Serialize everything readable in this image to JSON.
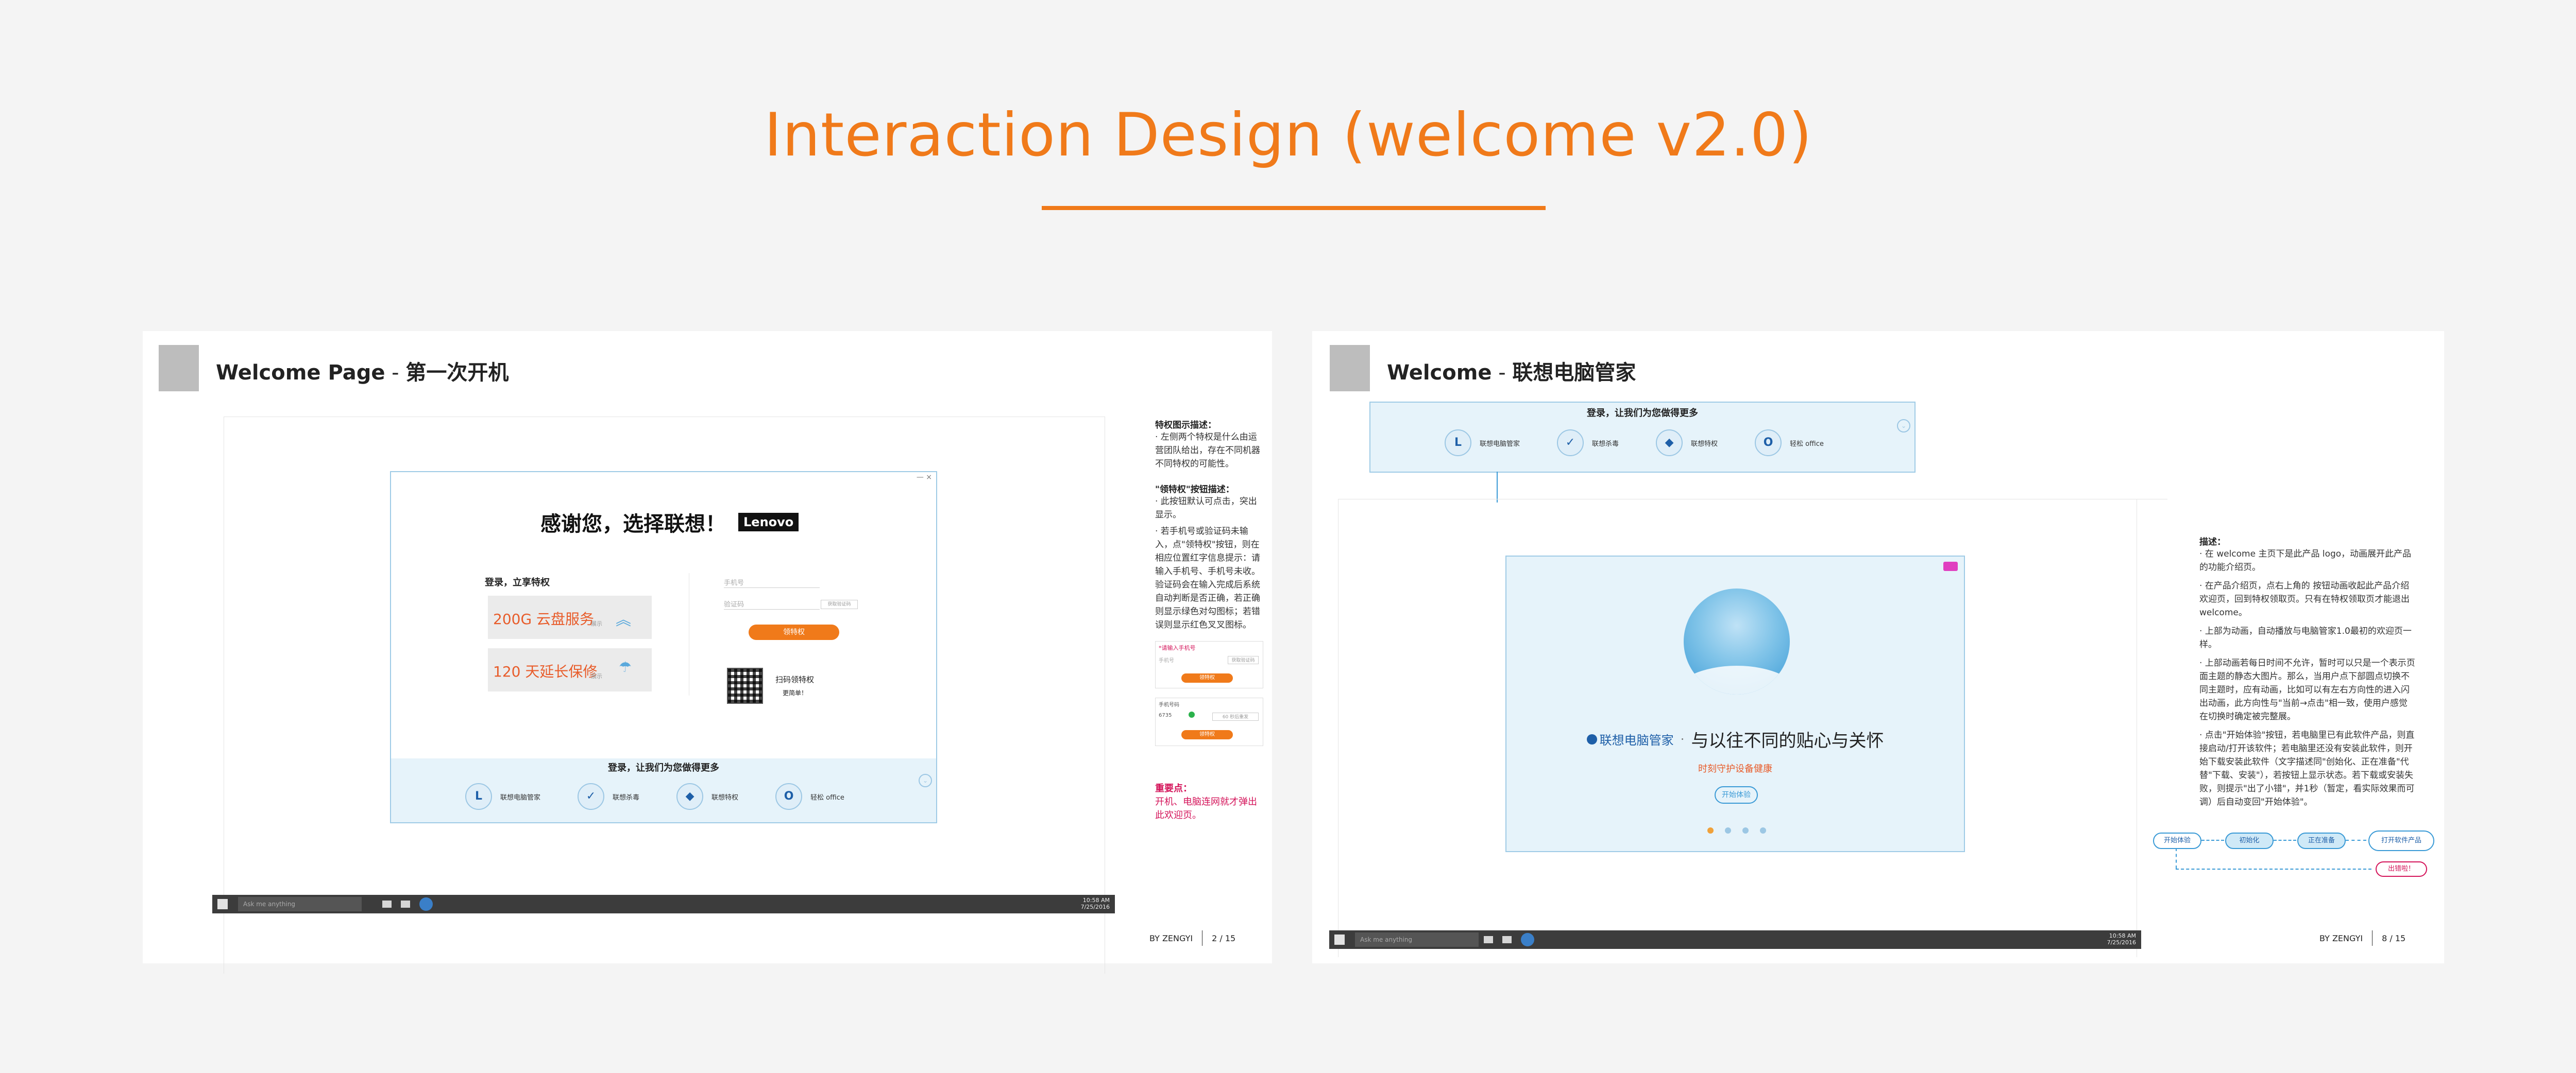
{
  "page": {
    "title": "Interaction Design (welcome v2.0)"
  },
  "slide1": {
    "heading_en": "Welcome Page",
    "heading_sep": " - ",
    "heading_cn": "第一次开机",
    "dialog": {
      "controls": "—   ×",
      "thanks": "感谢您，选择联想！",
      "brand": "Lenovo",
      "login_privilege": "登录，立享特权",
      "benefit1": "200G 云盘服务",
      "benefit2": "120 天延长保修",
      "benefit_tag": "展示",
      "phone_placeholder": "手机号",
      "code_placeholder": "验证码",
      "get_code": "获取验证码",
      "claim_button": "领特权",
      "scan_label": "扫码领特权",
      "scan_sub": "更简单！",
      "bar_title": "登录，让我们为您做得更多",
      "apps": [
        {
          "icon": "L",
          "label": "联想电脑管家"
        },
        {
          "icon": "✓",
          "label": "联想杀毒"
        },
        {
          "icon": "◆",
          "label": "联想特权"
        },
        {
          "icon": "O",
          "label": "轻松 office"
        }
      ]
    },
    "taskbar": {
      "search": "Ask me anything",
      "time": "10:58 AM",
      "date": "7/25/2016"
    },
    "notes": {
      "h1": "特权图示描述：",
      "p1": "· 左侧两个特权是什么由运营团队给出，存在不同机器不同特权的可能性。",
      "h2": "\"领特权\"按钮描述：",
      "p2": "· 此按钮默认可点击，突出显示。",
      "p3": "· 若手机号或验证码未输入，点\"领特权\"按钮，则在相应位置红字信息提示：请输入手机号、手机号未收。验证码会在输入完成后系统自动判断是否正确，若正确则显示绿色对勾图标；若错误则显示红色叉叉图标。",
      "mini1_error": "*请输入手机号",
      "mini1_phone": "手机号",
      "mini1_code": "获取验证码",
      "mini1_btn": "领特权",
      "mini2_phone": "手机号码",
      "mini2_code": "6735",
      "mini2_resend": "60 秒后重发",
      "mini2_btn": "领特权",
      "key_h": "重要点：",
      "key_p": "开机、电脑连网就才弹出此欢迎页。"
    },
    "footer": {
      "by": "BY ZENGYI",
      "page": "2 / 15"
    }
  },
  "slide2": {
    "heading_en": "Welcome",
    "heading_sep": " - ",
    "heading_cn": "联想电脑管家",
    "top_bar": {
      "title": "登录，让我们为您做得更多",
      "apps": [
        {
          "icon": "L",
          "label": "联想电脑管家"
        },
        {
          "icon": "✓",
          "label": "联想杀毒"
        },
        {
          "icon": "◆",
          "label": "联想特权"
        },
        {
          "icon": "O",
          "label": "轻松 office"
        }
      ]
    },
    "welcome": {
      "brand": "联想电脑管家",
      "dot_sep": "·",
      "slogan": "与以往不同的贴心与关怀",
      "subline": "时刻守护设备健康",
      "start_button": "开始体验"
    },
    "taskbar": {
      "search": "Ask me anything",
      "time": "10:58 AM",
      "date": "7/25/2016"
    },
    "notes": {
      "h": "描述：",
      "p1": "· 在 welcome 主页下是此产品 logo，动画展开此产品的功能介绍页。",
      "p2": "· 在产品介绍页，点右上角的    按钮动画收起此产品介绍欢迎页，回到特权领取页。只有在特权领取页才能退出 welcome。",
      "p3": "· 上部为动画，自动播放与电脑管家1.0最初的欢迎页一样。",
      "p4": "· 上部动画若每日时间不允许，暂时可以只是一个表示页面主题的静态大图片。那么，当用户点下部圆点切换不同主题时，应有动画，比如可以有左右方向性的进入闪出动画，此方向性与\"当前→点击\"相一致，使用户感觉在切换时确定被完整展。",
      "p5": "· 点击\"开始体验\"按钮，若电脑里已有此软件产品，则直接启动/打开该软件；若电脑里还没有安装此软件，则开始下载安装此软件（文字描述同\"创始化、正在准备\"代替\"下载、安装\"），若按钮上显示状态。若下载或安装失败，则提示\"出了小错\"，并1秒（暂定，看实际效果而可调）后自动变回\"开始体验\"。"
    },
    "flow": {
      "step1": "开始体验",
      "step2": "初始化",
      "step3": "正在准备",
      "step4": "打开软件产品",
      "fail": "出错啦！"
    },
    "footer": {
      "by": "BY ZENGYI",
      "page": "8 / 15"
    }
  }
}
